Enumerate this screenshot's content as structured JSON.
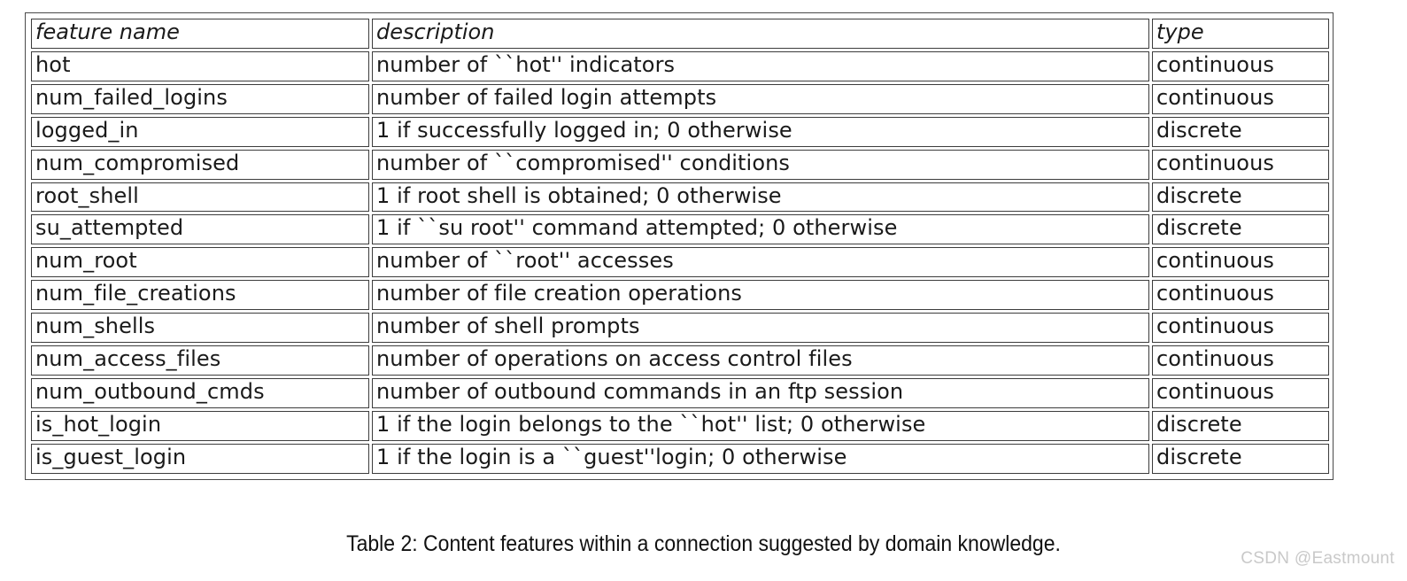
{
  "table": {
    "headers": [
      "feature name",
      "description",
      "type"
    ],
    "rows": [
      {
        "name": "hot",
        "description": "number of ``hot'' indicators",
        "type": "continuous"
      },
      {
        "name": "num_failed_logins",
        "description": "number of failed login attempts",
        "type": "continuous"
      },
      {
        "name": "logged_in",
        "description": "1 if successfully logged in; 0 otherwise",
        "type": "discrete"
      },
      {
        "name": "num_compromised",
        "description": "number of ``compromised'' conditions",
        "type": "continuous"
      },
      {
        "name": "root_shell",
        "description": "1 if root shell is obtained; 0 otherwise",
        "type": "discrete"
      },
      {
        "name": "su_attempted",
        "description": "1 if ``su root'' command attempted; 0 otherwise",
        "type": "discrete"
      },
      {
        "name": "num_root",
        "description": "number of ``root'' accesses",
        "type": "continuous"
      },
      {
        "name": "num_file_creations",
        "description": "number of file creation operations",
        "type": "continuous"
      },
      {
        "name": "num_shells",
        "description": "number of shell prompts",
        "type": "continuous"
      },
      {
        "name": "num_access_files",
        "description": "number of operations on access control files",
        "type": "continuous"
      },
      {
        "name": "num_outbound_cmds",
        "description": "number of outbound commands in an ftp session",
        "type": "continuous"
      },
      {
        "name": "is_hot_login",
        "description": "1 if the login belongs to the ``hot'' list; 0 otherwise",
        "type": "discrete"
      },
      {
        "name": "is_guest_login",
        "description": "1 if the login is a ``guest''login; 0 otherwise",
        "type": "discrete"
      }
    ]
  },
  "caption": "Table 2: Content features within a connection suggested by domain knowledge.",
  "watermark": "CSDN @Eastmount",
  "colors": {
    "border": "#3c3c3c",
    "outer_border": "#4a4a4a",
    "text": "#1a1a1a",
    "watermark": "#c9c9c9",
    "background": "#ffffff"
  }
}
